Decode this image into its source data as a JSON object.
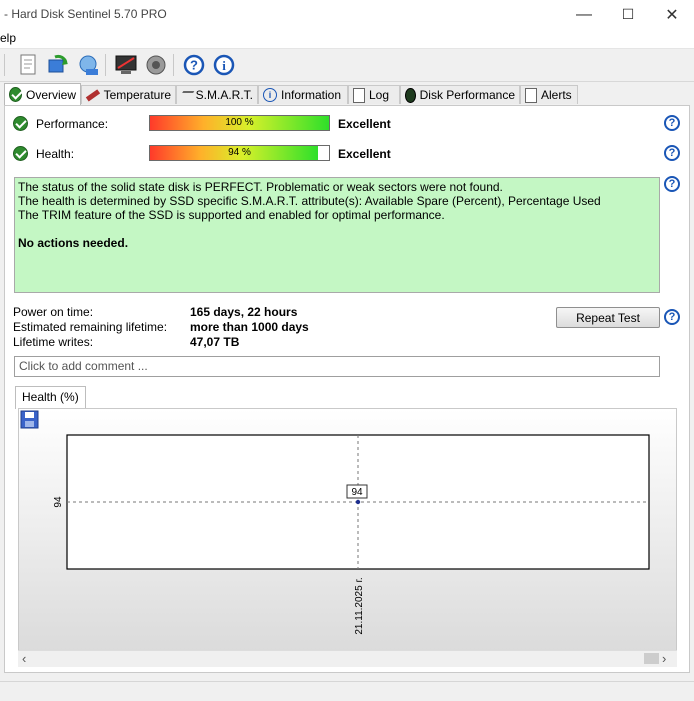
{
  "window": {
    "title": "- Hard Disk Sentinel 5.70 PRO",
    "minimize": "—",
    "maximize": "☐",
    "close": "✕"
  },
  "menu": {
    "help": "elp"
  },
  "toolbar_icons": [
    "report-icon",
    "refresh-icon",
    "globe-icon",
    "monitor-icon",
    "sound-icon",
    "help-icon",
    "info-icon"
  ],
  "tabs": [
    {
      "label": "Overview",
      "icon": "check-icon"
    },
    {
      "label": "Temperature",
      "icon": "thermometer-icon"
    },
    {
      "label": "S.M.A.R.T.",
      "icon": "smart-icon"
    },
    {
      "label": "Information",
      "icon": "info-icon"
    },
    {
      "label": "Log",
      "icon": "log-icon"
    },
    {
      "label": "Disk Performance",
      "icon": "gauge-icon"
    },
    {
      "label": "Alerts",
      "icon": "alert-icon"
    }
  ],
  "performance": {
    "label": "Performance:",
    "value": "100 %",
    "percent": 100,
    "rating": "Excellent"
  },
  "health": {
    "label": "Health:",
    "value": "94 %",
    "percent": 94,
    "rating": "Excellent"
  },
  "status": {
    "line1": "The status of the solid state disk is PERFECT. Problematic or weak sectors were not found.",
    "line2": "The health is determined by SSD specific S.M.A.R.T. attribute(s):  Available Spare (Percent), Percentage Used",
    "line3": "The TRIM feature of the SSD is supported and enabled for optimal performance.",
    "line4": "No actions needed.",
    "bg_color": "#c4f7c4"
  },
  "stats": [
    {
      "label": "Power on time:",
      "value": "165 days, 22 hours"
    },
    {
      "label": "Estimated remaining lifetime:",
      "value": "more than 1000 days"
    },
    {
      "label": "Lifetime writes:",
      "value": "47,07 TB"
    }
  ],
  "repeat_test_label": "Repeat Test",
  "comment_placeholder": "Click to add comment ...",
  "chart_tab_label": "Health (%)",
  "chart_data": {
    "type": "line",
    "title": "",
    "x": [
      "21.11.2025 г."
    ],
    "series": [
      {
        "values": [
          94
        ]
      }
    ],
    "data_labels": [
      "94"
    ],
    "ytick": "94",
    "xtick": "21.11.2025 г.",
    "grid": true
  }
}
